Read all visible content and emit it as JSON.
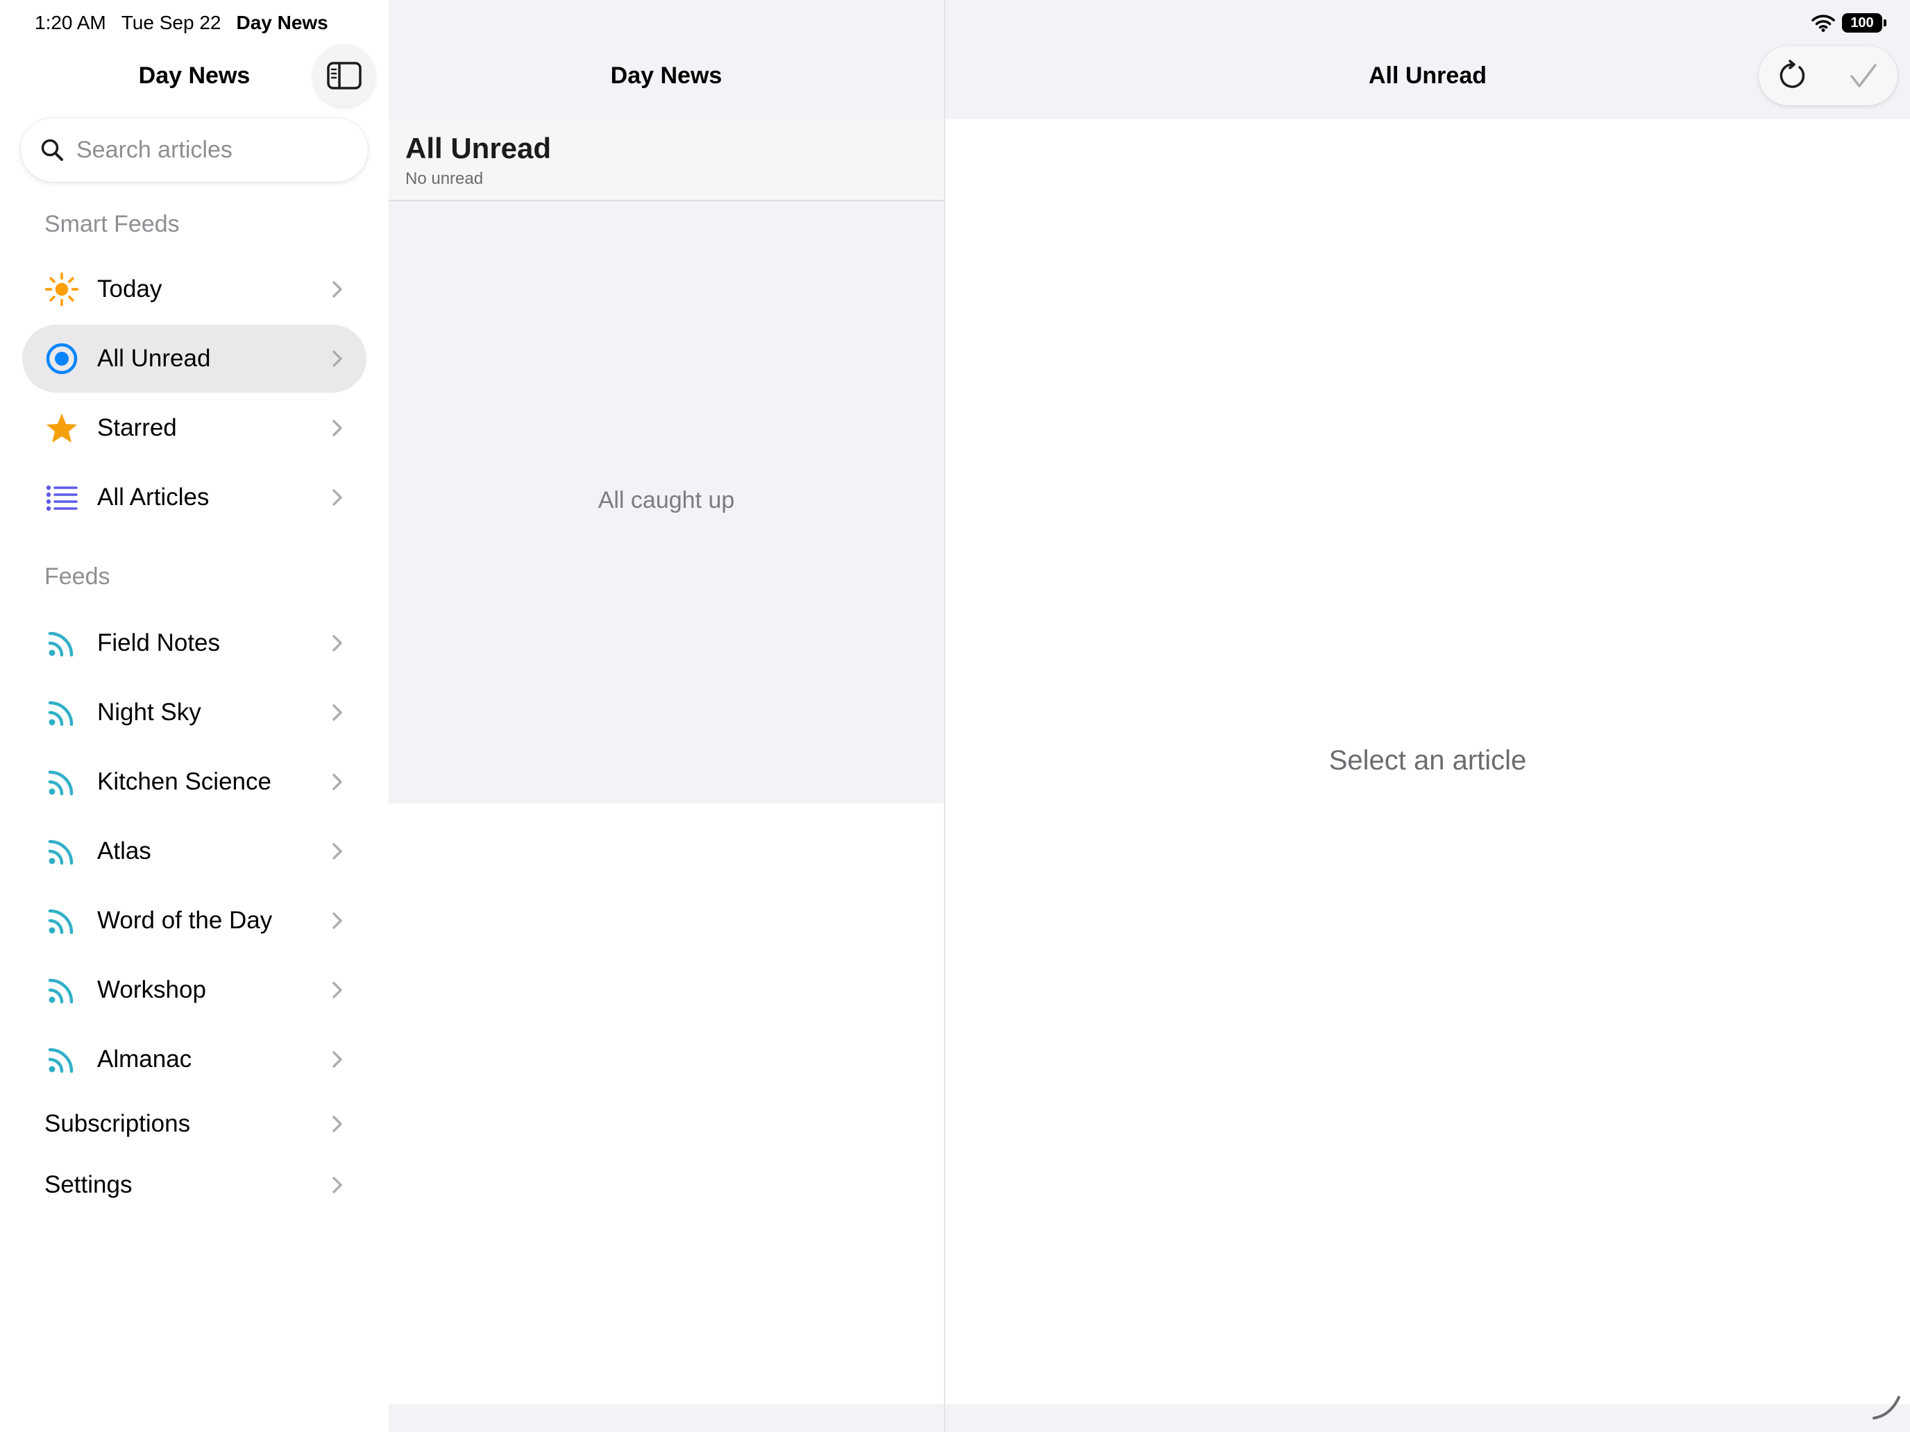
{
  "status_bar": {
    "time": "1:20 AM",
    "date": "Tue Sep 22",
    "app_name": "Day News",
    "battery": "100"
  },
  "sidebar": {
    "title": "Day News",
    "search_placeholder": "Search articles",
    "smart_feeds_header": "Smart Feeds",
    "smart_feeds": [
      {
        "label": "Today",
        "icon": "sun-icon",
        "color": "#FF9F0A"
      },
      {
        "label": "All Unread",
        "icon": "unread-circle-icon",
        "color": "#0A84FF",
        "selected": true
      },
      {
        "label": "Starred",
        "icon": "star-icon",
        "color": "#F5A00A"
      },
      {
        "label": "All Articles",
        "icon": "list-icon",
        "color": "#5E5CE6"
      }
    ],
    "feeds_header": "Feeds",
    "feeds": [
      {
        "label": "Field Notes",
        "icon": "rss-icon"
      },
      {
        "label": "Night Sky",
        "icon": "rss-icon"
      },
      {
        "label": "Kitchen Science",
        "icon": "rss-icon"
      },
      {
        "label": "Atlas",
        "icon": "rss-icon"
      },
      {
        "label": "Word of the Day",
        "icon": "rss-icon"
      },
      {
        "label": "Workshop",
        "icon": "rss-icon"
      },
      {
        "label": "Almanac",
        "icon": "rss-icon"
      }
    ],
    "rss_color": "#30B0C7",
    "subscriptions_label": "Subscriptions",
    "settings_label": "Settings"
  },
  "list": {
    "nav_title": "Day News",
    "header_title": "All Unread",
    "header_subtitle": "No unread",
    "empty_text": "All caught up"
  },
  "detail": {
    "nav_title": "All Unread",
    "empty_text": "Select an article"
  }
}
